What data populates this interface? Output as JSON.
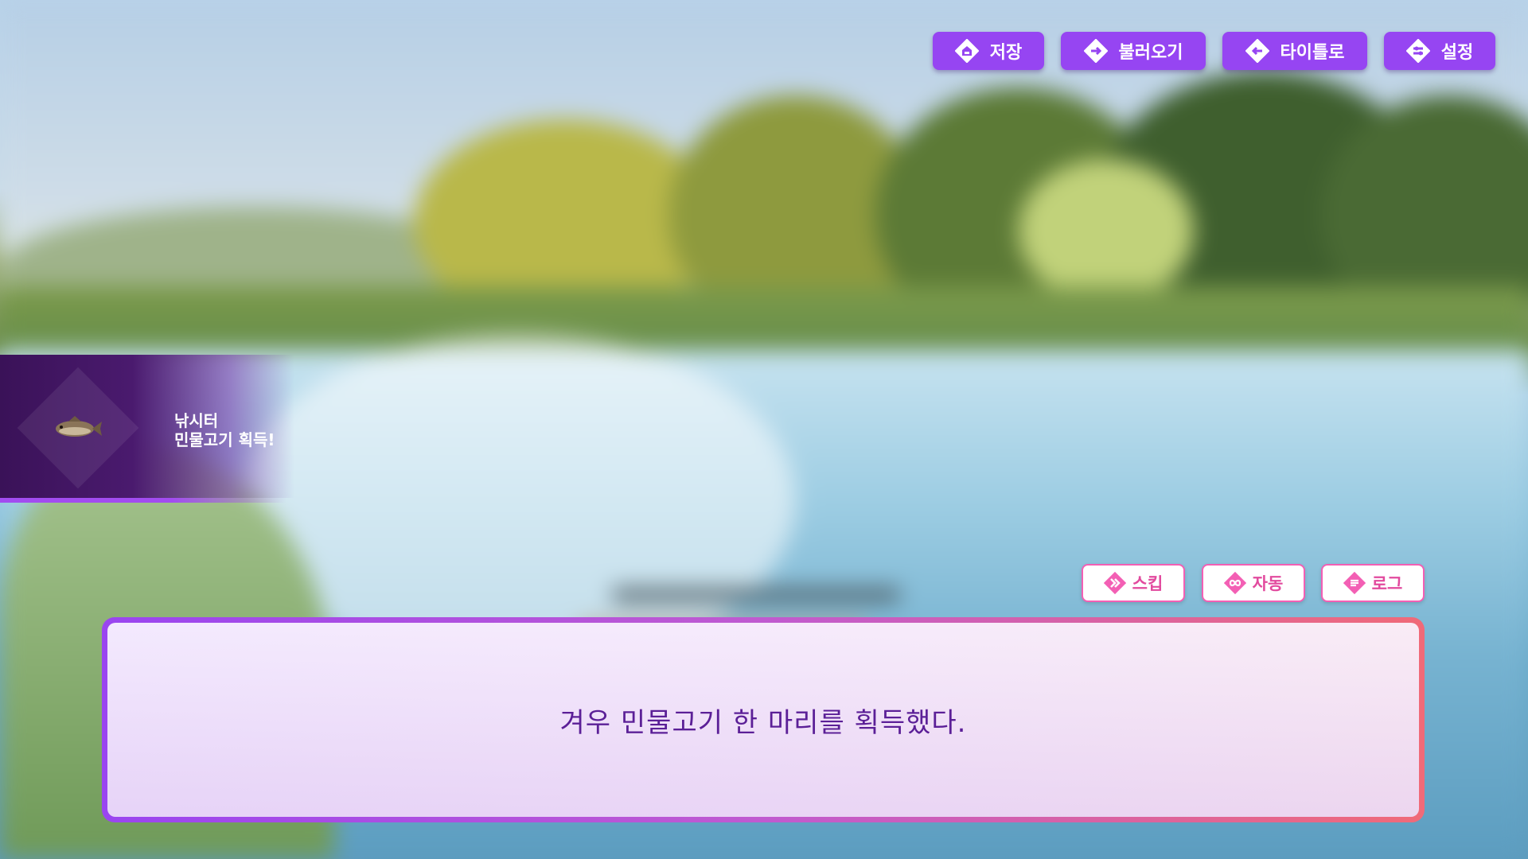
{
  "top_menu": {
    "save_label": "저장",
    "load_label": "불러오기",
    "title_label": "타이틀로",
    "settings_label": "설정"
  },
  "notification": {
    "location": "낚시터",
    "message": "민물고기 획득!",
    "item_icon": "fish-icon"
  },
  "controls": {
    "skip_label": "스킵",
    "auto_label": "자동",
    "log_label": "로그"
  },
  "dialogue": {
    "text": "겨우 민물고기 한 마리를 획득했다."
  },
  "colors": {
    "menu_button": "#9645f2",
    "control_border": "#f35fb4",
    "control_text": "#e24a9e",
    "dialogue_text": "#5b1f97",
    "notice_panel": "#3a1258"
  }
}
